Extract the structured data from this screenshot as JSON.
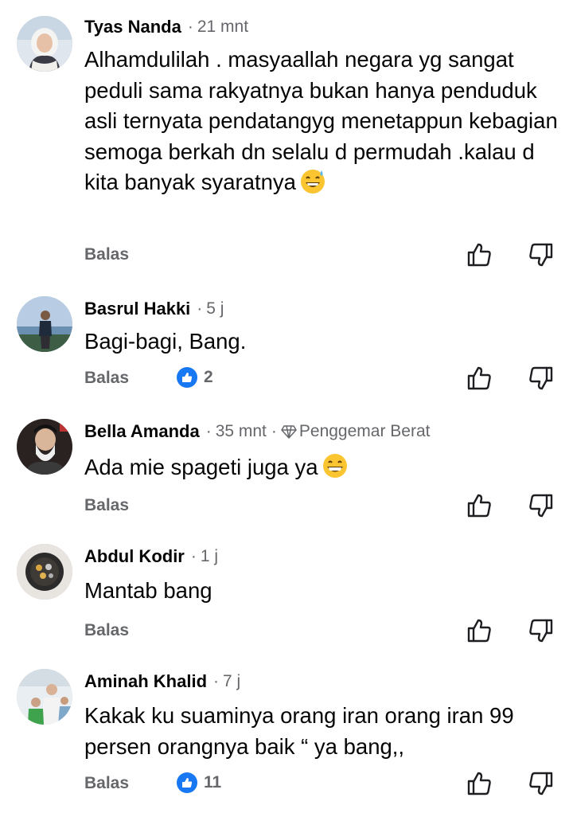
{
  "comments": [
    {
      "name": "Tyas Nanda",
      "time": "21 mnt",
      "text": "Alhamdulilah . masyaallah negara yg sangat peduli sama rakyatnya bukan hanya penduduk asli ternyata pendatangyg menetappun kebagian semoga berkah dn selalu d permudah .kalau d kita banyak syaratnya",
      "reply_label": "Balas",
      "avatar_icon": "profile-photo-woman-hijab",
      "emoji_icon": "grinning-sweat-emoji"
    },
    {
      "name": "Basrul Hakki",
      "time": "5 j",
      "text": "Bagi-bagi, Bang.",
      "reply_label": "Balas",
      "like_count": "2",
      "avatar_icon": "profile-photo-man-outdoor"
    },
    {
      "name": "Bella Amanda",
      "time": "35 mnt",
      "badge": "Penggemar Berat",
      "text": "Ada mie spageti juga ya",
      "reply_label": "Balas",
      "avatar_icon": "profile-photo-elder",
      "emoji_icon": "grinning-emoji"
    },
    {
      "name": "Abdul Kodir",
      "time": "1 j",
      "text": "Mantab bang",
      "reply_label": "Balas",
      "avatar_icon": "profile-photo-circular-logo"
    },
    {
      "name": "Aminah Khalid",
      "time": "7 j",
      "text": "Kakak ku suaminya orang iran orang iran 99 persen orangnya baik “ ya bang,,",
      "reply_label": "Balas",
      "like_count": "11",
      "avatar_icon": "profile-photo-family"
    }
  ],
  "colors": {
    "name_text": "#050505",
    "meta_text": "#65676b",
    "like_blue": "#1877f2"
  }
}
